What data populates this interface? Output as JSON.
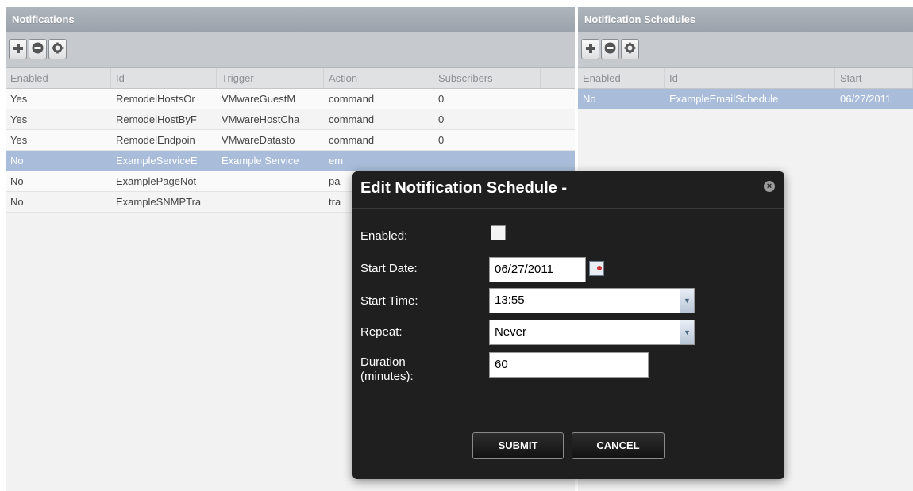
{
  "notifications": {
    "title": "Notifications",
    "columns": [
      "Enabled",
      "Id",
      "Trigger",
      "Action",
      "Subscribers"
    ],
    "rows": [
      {
        "enabled": "Yes",
        "id": "RemodelHostsOr",
        "trigger": "VMwareGuestM",
        "action": "command",
        "subscribers": "0",
        "selected": false
      },
      {
        "enabled": "Yes",
        "id": "RemodelHostByF",
        "trigger": "VMwareHostCha",
        "action": "command",
        "subscribers": "0",
        "selected": false
      },
      {
        "enabled": "Yes",
        "id": "RemodelEndpoin",
        "trigger": "VMwareDatasto",
        "action": "command",
        "subscribers": "0",
        "selected": false
      },
      {
        "enabled": "No",
        "id": "ExampleServiceE",
        "trigger": "Example Service",
        "action": "em",
        "subscribers": "",
        "selected": true
      },
      {
        "enabled": "No",
        "id": "ExamplePageNot",
        "trigger": "",
        "action": "pa",
        "subscribers": "",
        "selected": false
      },
      {
        "enabled": "No",
        "id": "ExampleSNMPTra",
        "trigger": "",
        "action": "tra",
        "subscribers": "",
        "selected": false
      }
    ]
  },
  "schedules": {
    "title": "Notification Schedules",
    "columns": [
      "Enabled",
      "Id",
      "Start"
    ],
    "rows": [
      {
        "enabled": "No",
        "id": "ExampleEmailSchedule",
        "start": "06/27/2011",
        "selected": true
      }
    ]
  },
  "modal": {
    "title": "Edit Notification Schedule -",
    "enabled_label": "Enabled:",
    "enabled_checked": false,
    "start_date_label": "Start Date:",
    "start_date_value": "06/27/2011",
    "start_time_label": "Start Time:",
    "start_time_value": "13:55",
    "repeat_label": "Repeat:",
    "repeat_value": "Never",
    "duration_label_1": "Duration",
    "duration_label_2": "(minutes):",
    "duration_value": "60",
    "submit_label": "SUBMIT",
    "cancel_label": "CANCEL"
  },
  "icons": {
    "add": "plus-icon",
    "remove": "minus-circle-icon",
    "settings": "gear-icon",
    "close": "close-icon",
    "calendar": "calendar-icon",
    "dropdown": "chevron-down-icon"
  },
  "colors": {
    "header": "#9aa2ab",
    "selected_row": "#a9bcd9",
    "modal_bg": "#161616"
  }
}
